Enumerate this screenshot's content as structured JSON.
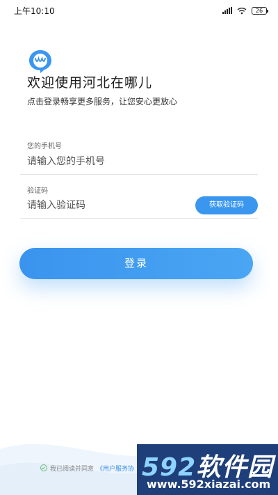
{
  "status_bar": {
    "time": "上午10:10",
    "battery": "26"
  },
  "header": {
    "title": "欢迎使用河北在哪儿",
    "subtitle": "点击登录畅享更多服务，让您安心更放心"
  },
  "form": {
    "phone_label": "您的手机号",
    "phone_placeholder": "请输入您的手机号",
    "code_label": "验证码",
    "code_placeholder": "请输入验证码",
    "get_code_label": "获取验证码",
    "login_label": "登录"
  },
  "agreement": {
    "text": "我已阅读并同意",
    "link": "《用户服务协"
  },
  "watermark": {
    "digits": "592",
    "name": "软件园",
    "url": "www.592xiazai.com"
  },
  "colors": {
    "primary": "#3a96ef",
    "check": "#6cc07a",
    "watermark_bg": "#1f3f7a"
  },
  "icons": [
    "signal-icon",
    "wifi-icon",
    "battery-icon",
    "logo-icon",
    "check-icon"
  ]
}
